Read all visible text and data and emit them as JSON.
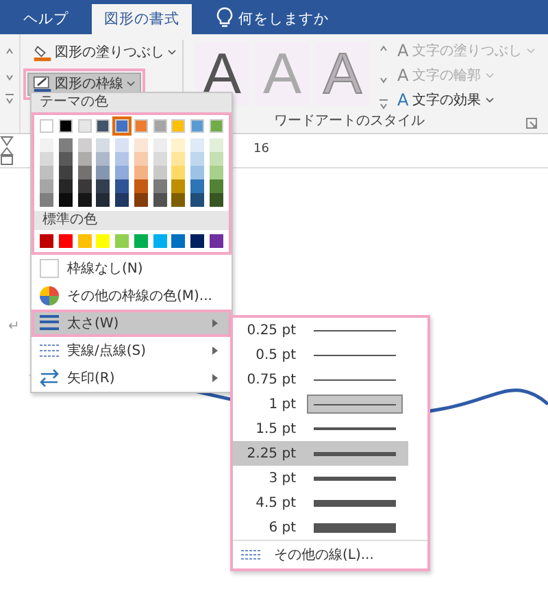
{
  "tabs": [
    {
      "label": "ヘルプ",
      "selected": false
    },
    {
      "label": "図形の書式",
      "selected": true
    }
  ],
  "tell_me": {
    "placeholder": "何をしますか"
  },
  "ribbon": {
    "shape_buttons": [
      {
        "label": "図形の塗りつぶし",
        "kind": "fill",
        "pressed": false,
        "highlight_box": false
      },
      {
        "label": "図形の枠線",
        "kind": "outline",
        "pressed": true,
        "highlight_box": true
      }
    ],
    "wordart_gallery": [
      {
        "kind": "dark",
        "sample": "A"
      },
      {
        "kind": "gray",
        "sample": "A"
      },
      {
        "kind": "outline",
        "sample": "A"
      }
    ],
    "text_buttons": [
      {
        "icon": "A",
        "label": "文字の塗りつぶし",
        "kind": "fill",
        "disabled": true
      },
      {
        "icon": "A",
        "label": "文字の輪郭",
        "kind": "outline",
        "disabled": true
      },
      {
        "icon": "A",
        "label": "文字の効果",
        "kind": "effects",
        "disabled": false
      }
    ],
    "group_label": "ワードアートのスタイル"
  },
  "ruler": {
    "number": "16"
  },
  "document": {
    "paragraph_mark": "↵"
  },
  "outline_menu": {
    "theme_header": "テーマの色",
    "highlight_box": true,
    "theme_colors": [
      {
        "color": "#ffffff",
        "selected": false,
        "shades": [
          {
            "color": "#f2f2f2"
          },
          {
            "color": "#d9d9d9"
          },
          {
            "color": "#bfbfbf"
          },
          {
            "color": "#a6a6a6"
          },
          {
            "color": "#808080"
          }
        ]
      },
      {
        "color": "#000000",
        "selected": false,
        "shades": [
          {
            "color": "#7f7f7f"
          },
          {
            "color": "#595959"
          },
          {
            "color": "#404040"
          },
          {
            "color": "#262626"
          },
          {
            "color": "#0d0d0d"
          }
        ]
      },
      {
        "color": "#e7e6e6",
        "selected": false,
        "shades": [
          {
            "color": "#d0cece"
          },
          {
            "color": "#aeabab"
          },
          {
            "color": "#757171"
          },
          {
            "color": "#3a3838"
          },
          {
            "color": "#171616"
          }
        ]
      },
      {
        "color": "#44546a",
        "selected": false,
        "shades": [
          {
            "color": "#d6dce4"
          },
          {
            "color": "#adb9ca"
          },
          {
            "color": "#8497b0"
          },
          {
            "color": "#333f4f"
          },
          {
            "color": "#222a35"
          }
        ]
      },
      {
        "color": "#4472c4",
        "selected": true,
        "shades": [
          {
            "color": "#d9e2f3"
          },
          {
            "color": "#b4c6e7"
          },
          {
            "color": "#8eaadb"
          },
          {
            "color": "#2f5496"
          },
          {
            "color": "#1f3864"
          }
        ]
      },
      {
        "color": "#ed7d31",
        "selected": false,
        "shades": [
          {
            "color": "#fbe5d5"
          },
          {
            "color": "#f7cbac"
          },
          {
            "color": "#f4b183"
          },
          {
            "color": "#c55a11"
          },
          {
            "color": "#843c0b"
          }
        ]
      },
      {
        "color": "#a5a5a5",
        "selected": false,
        "shades": [
          {
            "color": "#ededed"
          },
          {
            "color": "#dbdbdb"
          },
          {
            "color": "#c9c9c9"
          },
          {
            "color": "#7b7b7b"
          },
          {
            "color": "#525252"
          }
        ]
      },
      {
        "color": "#ffc000",
        "selected": false,
        "shades": [
          {
            "color": "#fff2cc"
          },
          {
            "color": "#fee599"
          },
          {
            "color": "#ffd965"
          },
          {
            "color": "#bf8f00"
          },
          {
            "color": "#7f6000"
          }
        ]
      },
      {
        "color": "#5b9bd5",
        "selected": false,
        "shades": [
          {
            "color": "#deebf6"
          },
          {
            "color": "#bdd7ee"
          },
          {
            "color": "#9cc3e5"
          },
          {
            "color": "#2e75b5"
          },
          {
            "color": "#1e4e79"
          }
        ]
      },
      {
        "color": "#70ad47",
        "selected": false,
        "shades": [
          {
            "color": "#e2efd9"
          },
          {
            "color": "#c5e0b3"
          },
          {
            "color": "#a8d08d"
          },
          {
            "color": "#538135"
          },
          {
            "color": "#375623"
          }
        ]
      }
    ],
    "standard_header": "標準の色",
    "standard_colors": [
      {
        "color": "#c00000"
      },
      {
        "color": "#ff0000"
      },
      {
        "color": "#ffc000"
      },
      {
        "color": "#ffff00"
      },
      {
        "color": "#92d050"
      },
      {
        "color": "#00b050"
      },
      {
        "color": "#00b0f0"
      },
      {
        "color": "#0070c0"
      },
      {
        "color": "#002060"
      },
      {
        "color": "#7030a0"
      }
    ],
    "items": [
      {
        "label": "枠線なし(N)",
        "kind": "no-line",
        "has_submenu": false,
        "highlighted": false,
        "highlight_box": false
      },
      {
        "label": "その他の枠線の色(M)...",
        "kind": "more-colors",
        "has_submenu": false,
        "highlighted": false,
        "highlight_box": false
      },
      {
        "label": "太さ(W)",
        "kind": "weight",
        "has_submenu": true,
        "highlighted": true,
        "highlight_box": true
      },
      {
        "label": "実線/点線(S)",
        "kind": "dash",
        "has_submenu": true,
        "highlighted": false,
        "highlight_box": false
      },
      {
        "label": "矢印(R)",
        "kind": "arrows",
        "has_submenu": true,
        "highlighted": false,
        "highlight_box": false
      }
    ]
  },
  "weight_menu": {
    "highlight_box": true,
    "weights": [
      {
        "label": "0.25 pt",
        "selected": false,
        "highlighted": false
      },
      {
        "label": "0.5 pt",
        "selected": false,
        "highlighted": false
      },
      {
        "label": "0.75 pt",
        "selected": false,
        "highlighted": false
      },
      {
        "label": "1 pt",
        "selected": true,
        "highlighted": false
      },
      {
        "label": "1.5 pt",
        "selected": false,
        "highlighted": false
      },
      {
        "label": "2.25 pt",
        "selected": false,
        "highlighted": true
      },
      {
        "label": "3 pt",
        "selected": false,
        "highlighted": false
      },
      {
        "label": "4.5 pt",
        "selected": false,
        "highlighted": false
      },
      {
        "label": "6 pt",
        "selected": false,
        "highlighted": false
      }
    ],
    "more": "その他の線(L)..."
  }
}
